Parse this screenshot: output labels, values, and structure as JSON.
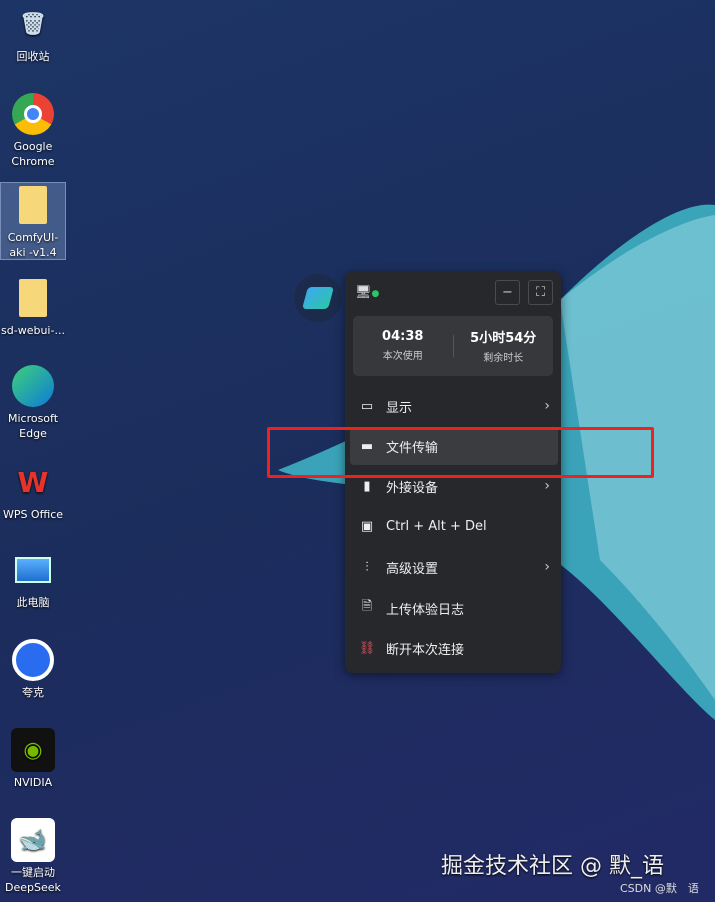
{
  "desktop_icons": [
    {
      "label": "回收站",
      "icon": "recycle-bin-icon"
    },
    {
      "label": "Google Chrome",
      "icon": "chrome-icon"
    },
    {
      "label": "ComfyUI-aki -v1.4",
      "icon": "folder-icon",
      "selected": true
    },
    {
      "label": "sd-webui-...",
      "icon": "folder-icon"
    },
    {
      "label": "Microsoft Edge",
      "icon": "edge-icon"
    },
    {
      "label": "WPS Office",
      "icon": "wps-icon"
    },
    {
      "label": "此电脑",
      "icon": "computer-icon"
    },
    {
      "label": "夸克",
      "icon": "quark-icon"
    },
    {
      "label": "NVIDIA",
      "icon": "nvidia-icon"
    },
    {
      "label": "一键启动 DeepSeek",
      "icon": "deepseek-icon"
    }
  ],
  "panel": {
    "minimize": "−",
    "fullscreen": "⛶",
    "session_time": "04:38",
    "session_label": "本次使用",
    "remaining_time": "5小时54分",
    "remaining_label": "剩余时长",
    "menu": [
      {
        "label": "显示",
        "icon": "display-icon",
        "submenu": true
      },
      {
        "label": "文件传输",
        "icon": "folder-icon",
        "highlighted": true
      },
      {
        "label": "外接设备",
        "icon": "usb-icon",
        "submenu": true
      },
      {
        "label": "Ctrl + Alt + Del",
        "icon": "monitor-key-icon"
      },
      {
        "label": "高级设置",
        "icon": "sliders-icon",
        "submenu": true
      },
      {
        "label": "上传体验日志",
        "icon": "upload-log-icon"
      },
      {
        "label": "断开本次连接",
        "icon": "disconnect-icon"
      }
    ]
  },
  "watermark": "掘金技术社区 @ 默_语",
  "watermark_small": "CSDN @默　语"
}
